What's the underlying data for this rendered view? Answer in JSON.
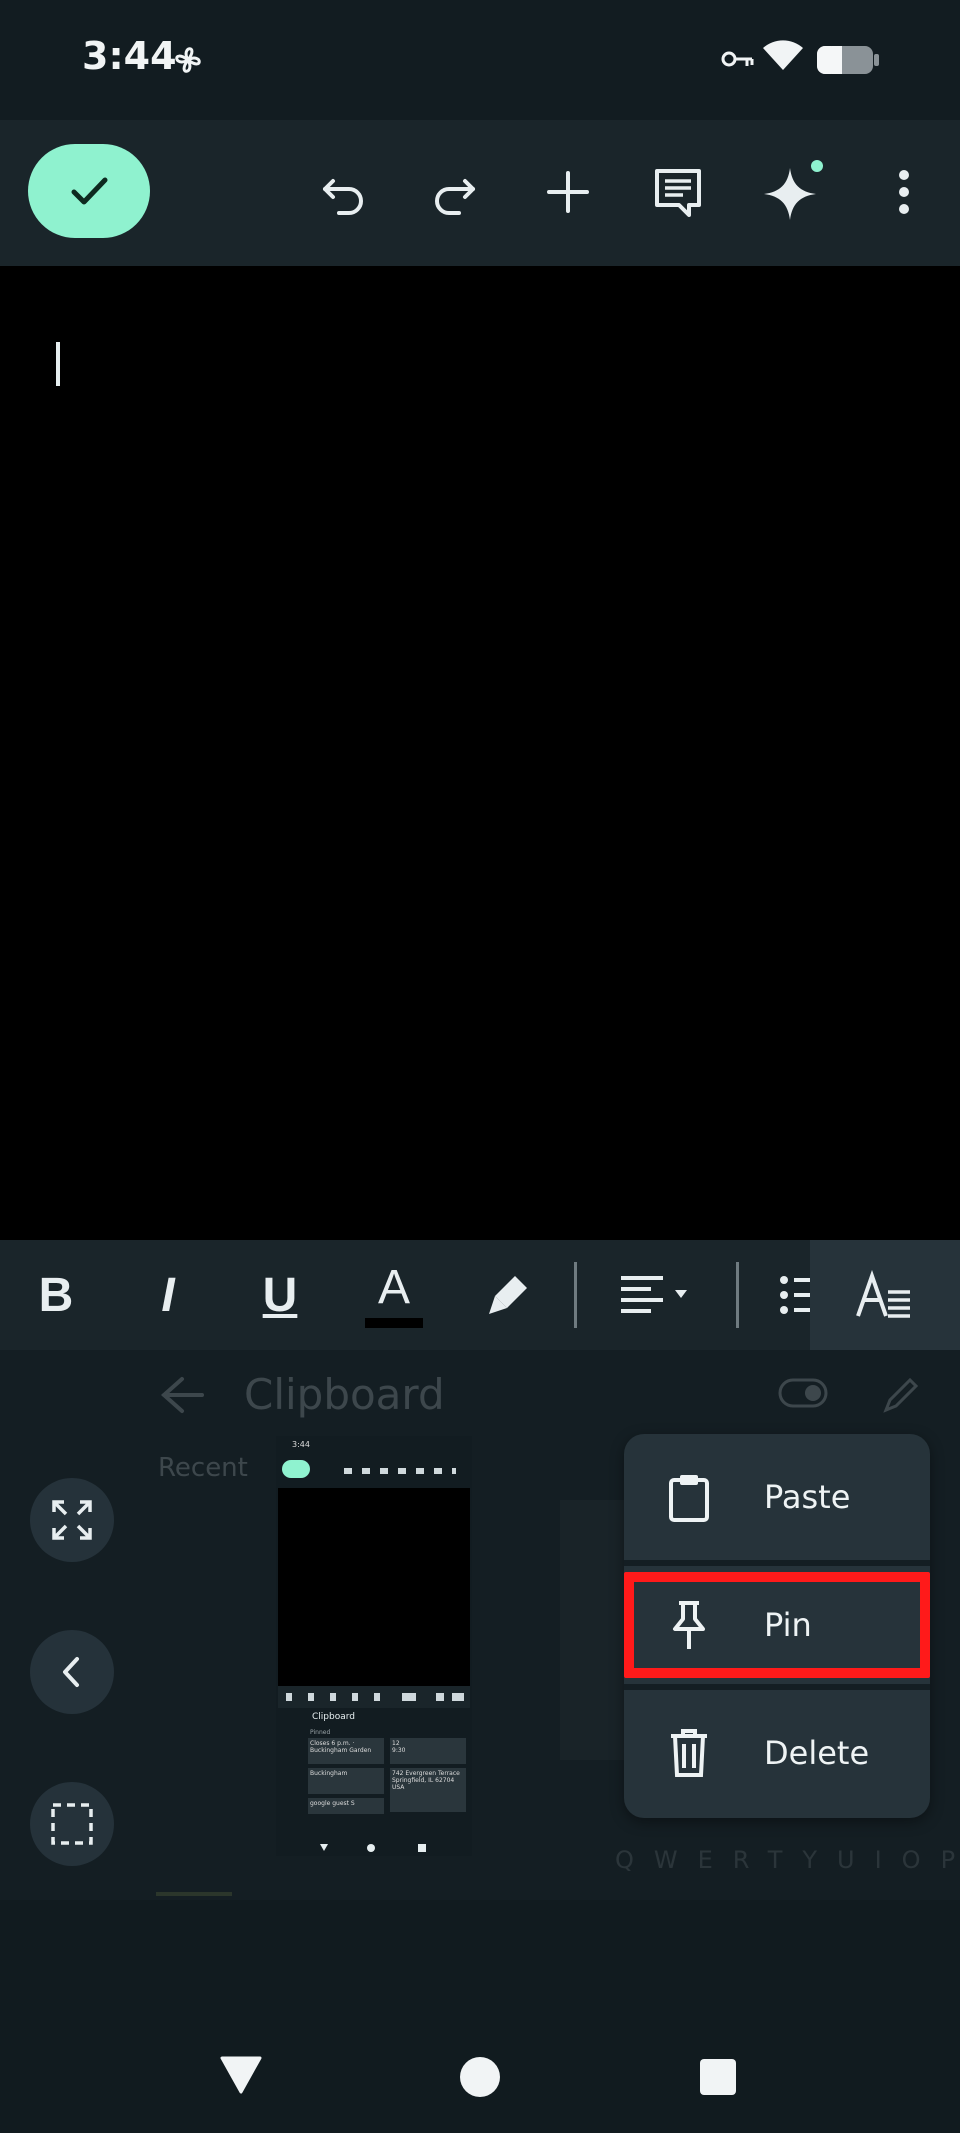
{
  "status_bar": {
    "time": "3:44",
    "icons": [
      "fan-icon",
      "vpn-key-icon",
      "wifi-icon",
      "battery-icon"
    ]
  },
  "toolbar": {
    "icons": [
      "check-icon",
      "undo-icon",
      "redo-icon",
      "add-icon",
      "comment-icon",
      "gemini-sparkle-icon",
      "more-vert-icon"
    ],
    "accent": "#8ff2cf"
  },
  "format_toolbar": {
    "bold": "B",
    "italic": "I",
    "underline": "U",
    "text_color": "A",
    "icons": [
      "highlighter-icon",
      "align-left-icon",
      "bulleted-list-icon",
      "text-style-icon"
    ]
  },
  "clipboard": {
    "title": "Clipboard",
    "recent_label": "Recent",
    "side_buttons": [
      "expand-icon",
      "back-icon",
      "select-region-icon"
    ],
    "thumbnail": {
      "time": "3:44",
      "title": "Clipboard",
      "recent": "Pinned",
      "cards": [
        "Closes 6 p.m. · Buckingham Garden",
        "12",
        "9:30",
        "Buckingham",
        "742 Evergreen Terrace Springfield, IL 62704 USA",
        "google guest S"
      ]
    },
    "ghost_keys": "QWERTYUIOP"
  },
  "context_menu": {
    "items": [
      {
        "label": "Paste",
        "icon": "clipboard-icon"
      },
      {
        "label": "Pin",
        "icon": "pin-icon"
      },
      {
        "label": "Delete",
        "icon": "trash-icon"
      }
    ],
    "highlight_color": "#ff1a1a"
  },
  "nav_bar": {
    "icons": [
      "back-triangle-icon",
      "home-circle-icon",
      "recents-square-icon"
    ]
  }
}
